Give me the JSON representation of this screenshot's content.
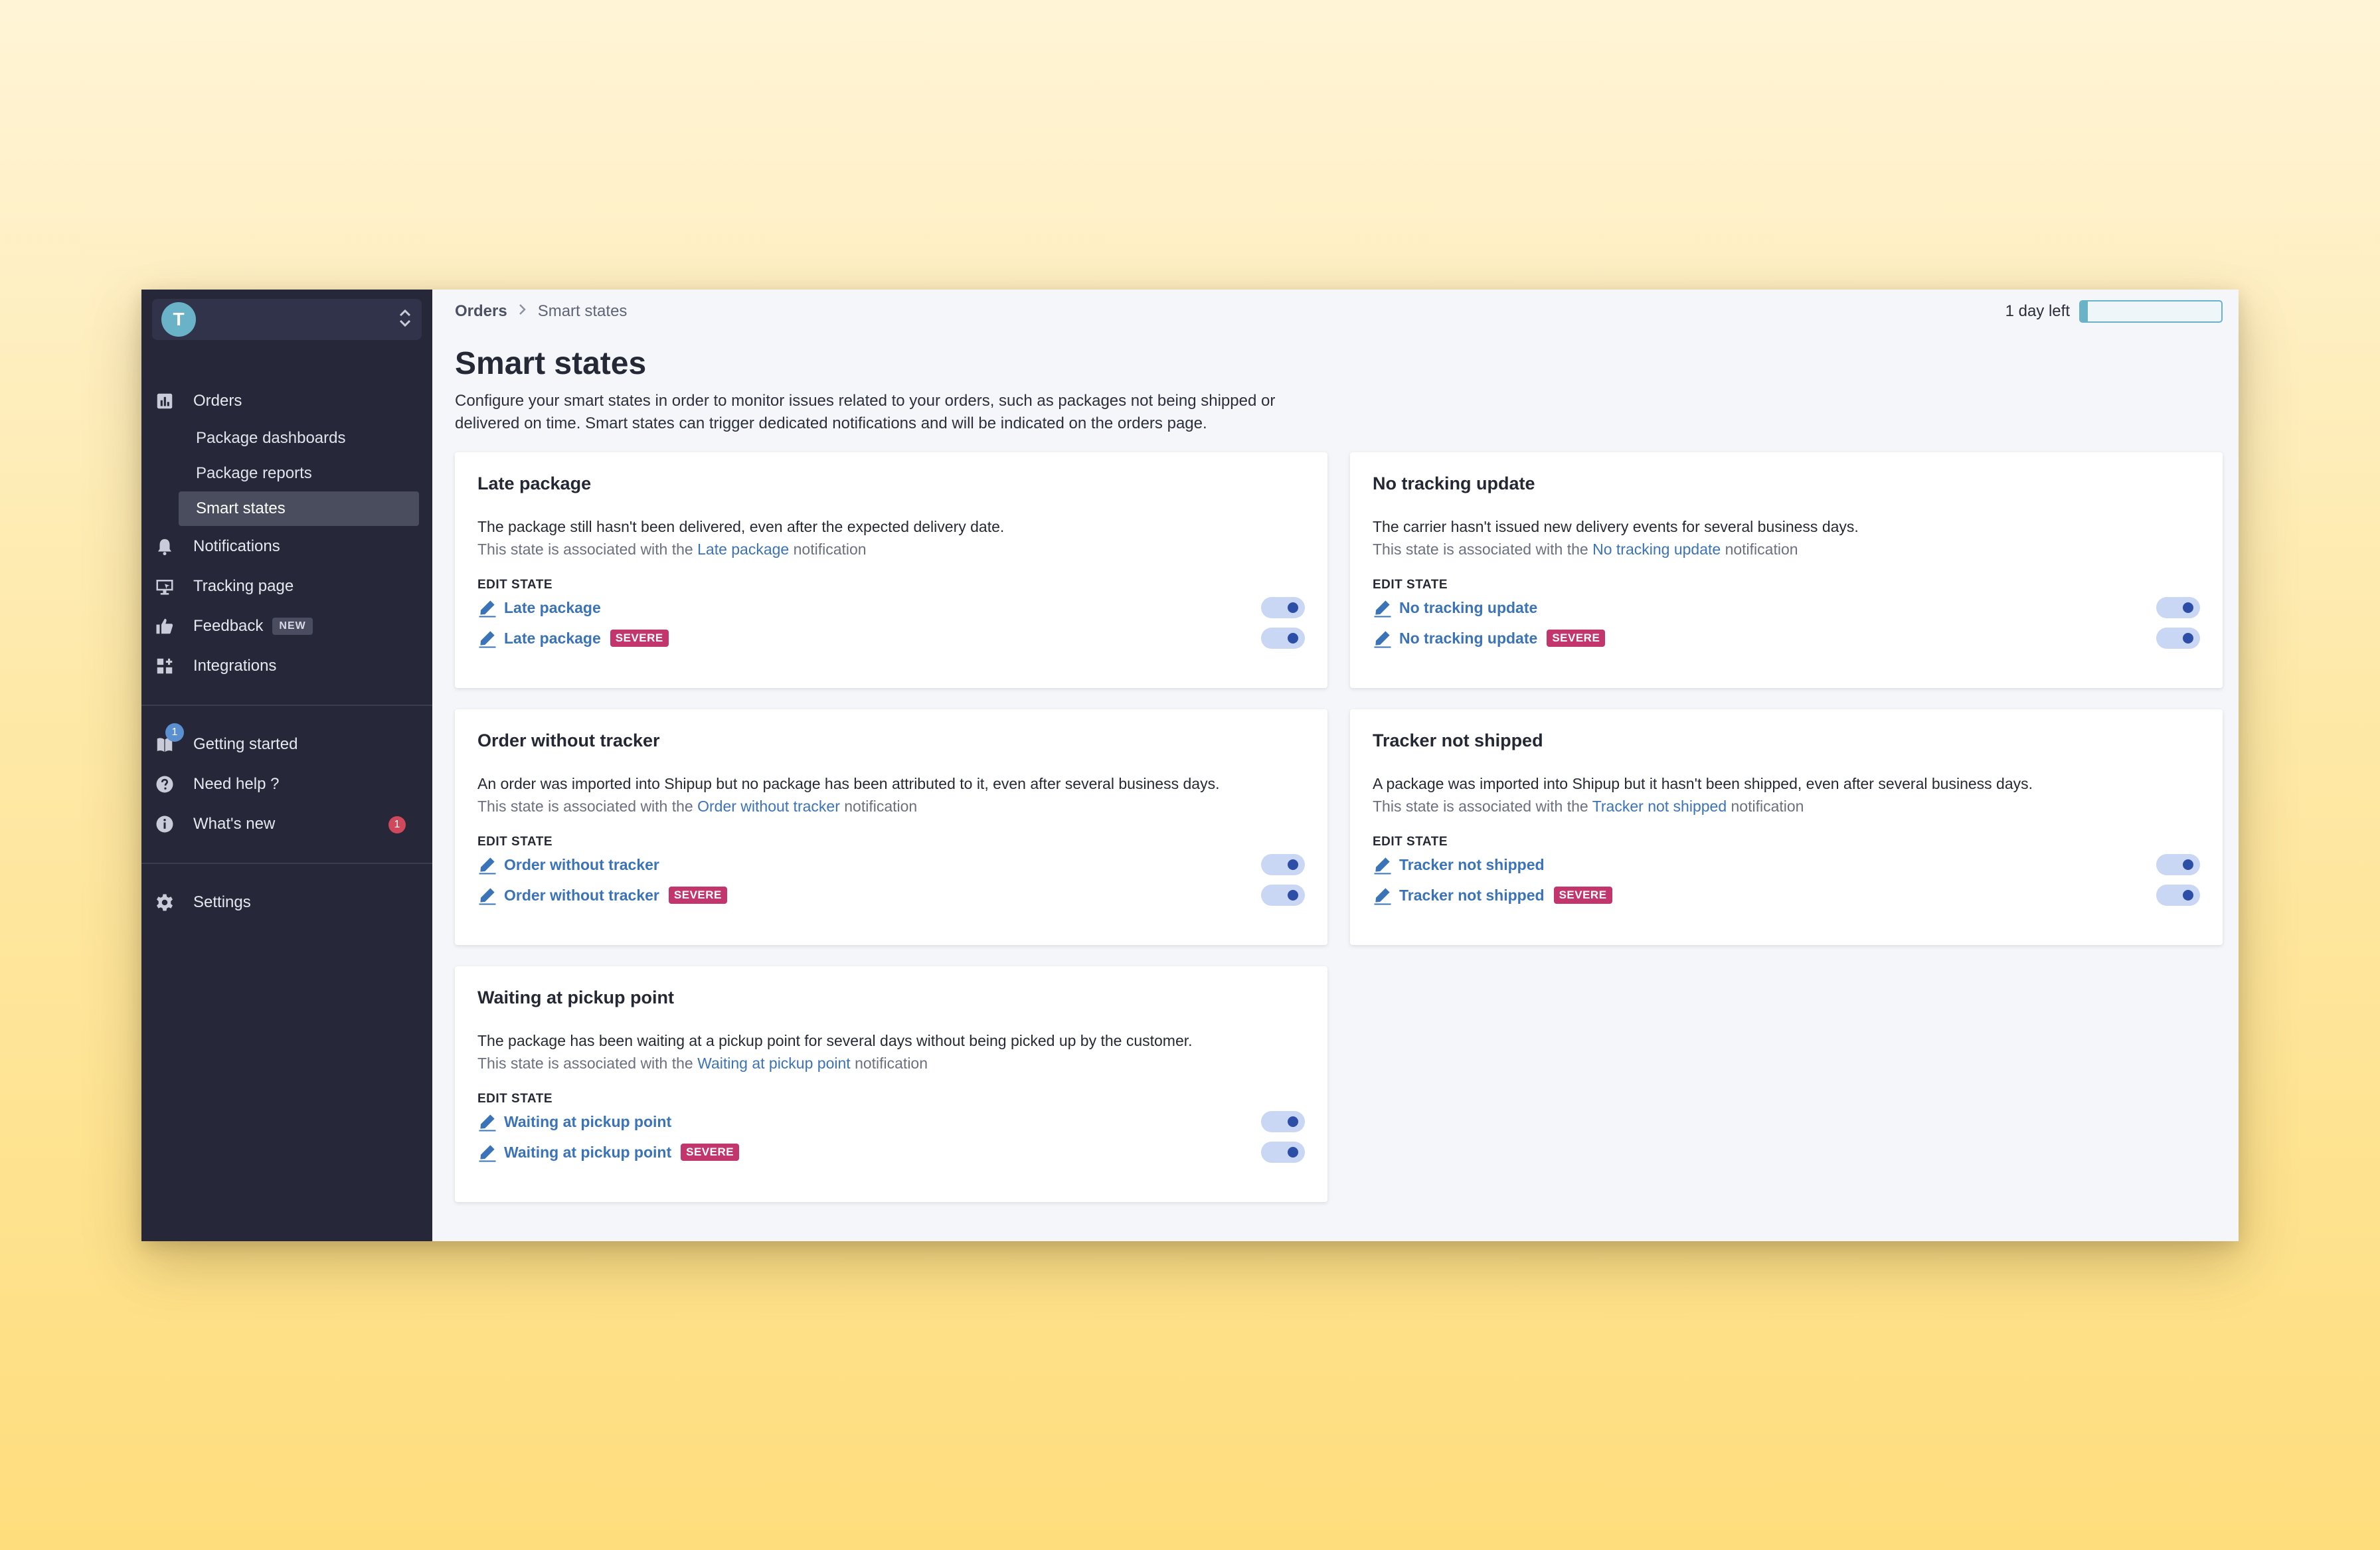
{
  "workspace": {
    "avatar_letter": "T",
    "chevron": "⌃⌄"
  },
  "sidebar": {
    "items": [
      {
        "label": "Orders",
        "icon": "chart-icon"
      },
      {
        "label": "Notifications",
        "icon": "bell-icon"
      },
      {
        "label": "Tracking page",
        "icon": "monitor-icon"
      },
      {
        "label": "Feedback",
        "icon": "thumbs-up-icon",
        "badge": "NEW"
      },
      {
        "label": "Integrations",
        "icon": "grid-icon"
      },
      {
        "label": "Getting started",
        "icon": "book-icon",
        "badge": "1"
      },
      {
        "label": "Need help ?",
        "icon": "question-icon"
      },
      {
        "label": "What's new",
        "icon": "info-icon",
        "badge": "1"
      },
      {
        "label": "Settings",
        "icon": "gear-icon"
      }
    ],
    "orders_sub": [
      "Package dashboards",
      "Package reports",
      "Smart states"
    ]
  },
  "breadcrumb": {
    "root": "Orders",
    "current": "Smart states"
  },
  "trial": {
    "label": "1 day left",
    "progress_fraction": 0.05
  },
  "page": {
    "title": "Smart states",
    "description": "Configure your smart states in order to monitor issues related to your orders, such as packages not being shipped or delivered on time. Smart states can trigger dedicated notifications and will be indicated on the orders page."
  },
  "common": {
    "assoc_prefix": "This state is associated with the",
    "assoc_suffix": "notification",
    "edit_state": "EDIT STATE",
    "severe": "SEVERE"
  },
  "cards": [
    {
      "title": "Late package",
      "description": "The package still hasn't been delivered, even after the expected delivery date.",
      "link": "Late package"
    },
    {
      "title": "No tracking update",
      "description": "The carrier hasn't issued new delivery events for several business days.",
      "link": "No tracking update"
    },
    {
      "title": "Order without tracker",
      "description": "An order was imported into Shipup but no package has been attributed to it, even after several business days.",
      "link": "Order without tracker"
    },
    {
      "title": "Tracker not shipped",
      "description": "A package was imported into Shipup but it hasn't been shipped, even after several business days.",
      "link": "Tracker not shipped"
    },
    {
      "title": "Waiting at pickup point",
      "description": "The package has been waiting at a pickup point for several days without being picked up by the customer.",
      "link": "Waiting at pickup point"
    }
  ],
  "colors": {
    "sidebar_bg": "#262839",
    "accent": "#3b73b8",
    "severe": "#c2366d",
    "toggle_on": "#2d4ea6",
    "avatar": "#6ab2c7"
  }
}
